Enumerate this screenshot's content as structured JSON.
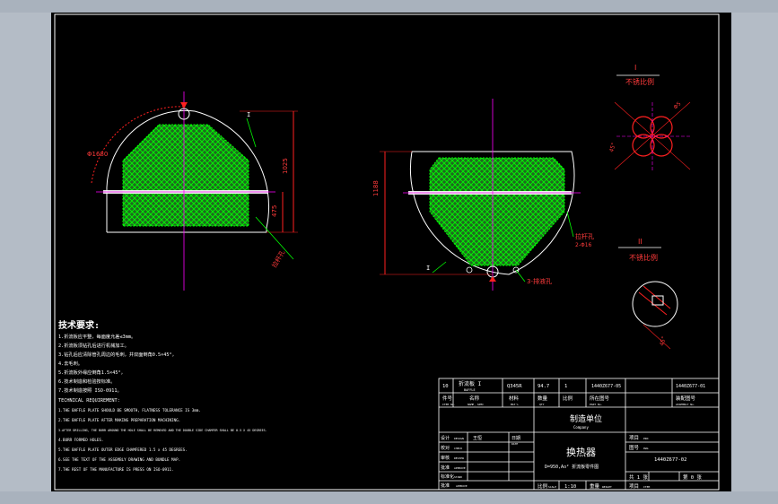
{
  "app": {
    "background": "#000000",
    "frame_color": "#b4bcc6"
  },
  "colors": {
    "line": "#ffffff",
    "hatch": "#00ff00",
    "fill": "#1f6b1f",
    "dimension": "#ff2020",
    "centerline": "#ff00ff",
    "table_text": "#00ffff",
    "leader": "#00ff00"
  },
  "views": {
    "left": {
      "ref_label": "I",
      "dim_radius": "Φ1680",
      "dim_height": "1025",
      "dim_small": "475",
      "note": "拉杆孔"
    },
    "right": {
      "ref_label": "I",
      "dim_height": "1188",
      "note_holes": "拉杆孔",
      "note_holes_sub": "2-Φ16",
      "note_bottom": "3-排液孔"
    },
    "detail_i": {
      "title": "I",
      "subtitle": "不锈比例",
      "dim_1": "Φ5",
      "dim_2": "45°"
    },
    "detail_ii": {
      "title": "II",
      "subtitle": "不锈比例",
      "dim_1": "45°"
    }
  },
  "notes": {
    "title": "技术要求:",
    "lines": [
      "1.折流板应平整，每面度允差≤3mm。",
      "2.折流板须钻孔后进行机械加工。",
      "3.钻孔后应清除管孔周边的毛刺，并双面倒角0.5×45°，",
      "4.去毛刺。",
      "5.折流板外缘应倒角1.5×45°，",
      "6.技术制造和检验按标准。",
      "7.技术制造按照 ISO-0911。",
      "TECHNICAL REQUIREMENT:",
      "1.THE BAFFLE PLATE SHOULD BE SMOOTH, FLATNESS TOLERANCE IS 3mm.",
      "2.THE BAFFLE PLATE AFTER MAKING PREPARATION MACHINING.",
      "3.AFTER DRILLING, THE BURR AROUND THE HOLE SHALL BE REMOVED AND THE DOUBLE SIDE CHAMFER SHALL BE 0.5 X 45 DEGREES.",
      "4.BURR FORMED HOLES.",
      "5.THE BAFFLE PLATE OUTER EDGE CHAMFERED 1.5 x 45 DEGREES.",
      "6.SEE THE TEXT OF THE ASSEMBLY DRAWING AND BUNDLE MAP.",
      "7.THE REST OF THE MANUFACTURE IS PRESS ON ISO-0911."
    ]
  },
  "title_block": {
    "part_row": [
      "10",
      "折流板 I",
      "Q345R",
      "94.7",
      "1",
      "1440Z677-05",
      "1440Z677-01"
    ],
    "part_row_sub": [
      "",
      "BAFFLE",
      "",
      "",
      "",
      "",
      ""
    ],
    "header_row": [
      "件号",
      "名称",
      "材料",
      "数量",
      "比例",
      "所在图号",
      "装配图号"
    ],
    "header_row_sub": [
      "ITEM No.",
      "NAME, SPEC",
      "MAT'L",
      "QTY",
      "",
      "PART No.",
      "ASSEMBLY No."
    ],
    "company": "制造单位",
    "company_sub": "Company",
    "sign_rows": [
      {
        "label": "设计",
        "sub": "DESIGN",
        "name": "王恒"
      },
      {
        "label": "校对",
        "sub": "CHECK",
        "name": ""
      },
      {
        "label": "审核",
        "sub": "REVIEW",
        "name": ""
      },
      {
        "label": "批准",
        "sub": "APPROVE",
        "name": ""
      },
      {
        "label": "标准化",
        "sub": "STAND",
        "name": ""
      },
      {
        "label": "批准",
        "sub": "APPROVE",
        "name": ""
      }
    ],
    "date_label": "日期",
    "date_sub": "DATE",
    "drawing_title": "换热器",
    "drawing_subtitle": "D=950,Ao²  折流板零件图",
    "project_label": "项目",
    "project_sub": "PRO",
    "drawing_no_label": "图号",
    "drawing_no_sub": "DWG",
    "drawing_no": "1440Z677-02",
    "scale_label": "比例",
    "scale_sub": "SCALE",
    "scale": "1:10",
    "weight_label": "重量",
    "weight_sub": "WEIGHT",
    "sheets_label": "共 1 张",
    "sheet_label": "第 0 张",
    "item_label": "项目",
    "item_sub": "ITEM"
  }
}
